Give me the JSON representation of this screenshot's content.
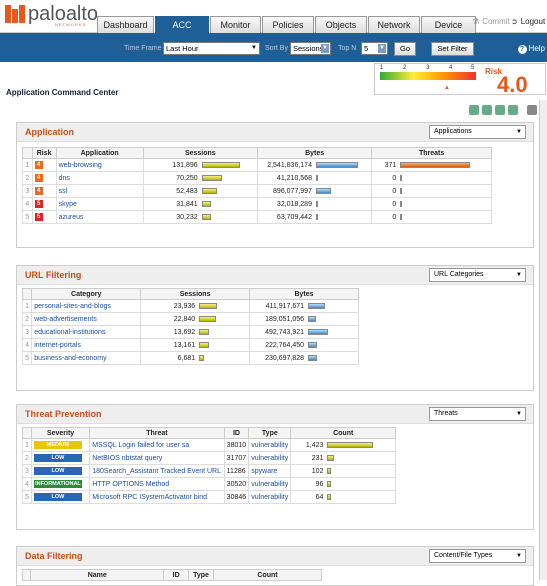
{
  "header": {
    "logo_text": "paloalto",
    "logo_sub": "NETWORKS",
    "tabs": [
      "Dashboard",
      "ACC",
      "Monitor",
      "Policies",
      "Objects",
      "Network",
      "Device"
    ],
    "commit": "Commit",
    "logout": "Logout"
  },
  "toolbar": {
    "time_frame_label": "Time Frame",
    "time_frame_value": "Last Hour",
    "sort_by_label": "Sort By",
    "sort_by_value": "Sessions",
    "top_n_label": "Top N",
    "top_n_value": "5",
    "go": "Go",
    "set_filter": "Set Filter",
    "help": "Help"
  },
  "page_title": "Application Command Center",
  "risk": {
    "label": "Risk",
    "value": "4.0",
    "ticks": [
      "1",
      "2",
      "3",
      "4",
      "5"
    ]
  },
  "application": {
    "title": "Application",
    "select": "Applications",
    "columns": [
      "Risk",
      "Application",
      "Sessions",
      "Bytes",
      "Threats"
    ],
    "rows": [
      {
        "n": "1",
        "risk": "4",
        "app": "web-browsing",
        "sessions": "131,896",
        "sessions_frac": 1.0,
        "bytes": "2,541,836,174",
        "bytes_frac": 1.0,
        "threats": "371",
        "threats_frac": 1.0
      },
      {
        "n": "2",
        "risk": "4",
        "app": "dns",
        "sessions": "70,250",
        "sessions_frac": 0.53,
        "bytes": "41,210,568",
        "bytes_frac": 0.02,
        "threats": "0",
        "threats_frac": 0
      },
      {
        "n": "3",
        "risk": "4",
        "app": "ssl",
        "sessions": "52,483",
        "sessions_frac": 0.4,
        "bytes": "896,077,997",
        "bytes_frac": 0.35,
        "threats": "0",
        "threats_frac": 0
      },
      {
        "n": "4",
        "risk": "5",
        "app": "skype",
        "sessions": "31,841",
        "sessions_frac": 0.24,
        "bytes": "32,018,289",
        "bytes_frac": 0.02,
        "threats": "0",
        "threats_frac": 0
      },
      {
        "n": "5",
        "risk": "5",
        "app": "azureus",
        "sessions": "30,232",
        "sessions_frac": 0.23,
        "bytes": "63,709,442",
        "bytes_frac": 0.03,
        "threats": "0",
        "threats_frac": 0
      }
    ]
  },
  "url_filtering": {
    "title": "URL Filtering",
    "select": "URL Categories",
    "columns": [
      "Category",
      "Sessions",
      "Bytes"
    ],
    "rows": [
      {
        "n": "1",
        "cat": "personal-sites-and-blogs",
        "sessions": "23,936",
        "sessions_frac": 1.0,
        "bytes": "411,917,671",
        "bytes_frac": 0.84
      },
      {
        "n": "2",
        "cat": "web-advertisements",
        "sessions": "22,840",
        "sessions_frac": 0.95,
        "bytes": "189,051,056",
        "bytes_frac": 0.38
      },
      {
        "n": "3",
        "cat": "educational-institutions",
        "sessions": "13,692",
        "sessions_frac": 0.57,
        "bytes": "492,743,921",
        "bytes_frac": 1.0
      },
      {
        "n": "4",
        "cat": "internet-portals",
        "sessions": "13,161",
        "sessions_frac": 0.55,
        "bytes": "222,764,450",
        "bytes_frac": 0.45
      },
      {
        "n": "5",
        "cat": "business-and-economy",
        "sessions": "6,681",
        "sessions_frac": 0.28,
        "bytes": "230,697,828",
        "bytes_frac": 0.47
      }
    ]
  },
  "threat_prevention": {
    "title": "Threat Prevention",
    "select": "Threats",
    "columns": [
      "Severity",
      "Threat",
      "ID",
      "Type",
      "Count"
    ],
    "rows": [
      {
        "n": "1",
        "sev": "MEDIUM",
        "sev_color": "#e8c800",
        "threat": "MSSQL Login failed for user sa",
        "id": "38010",
        "type": "vulnerability",
        "count": "1,423",
        "count_frac": 1.0
      },
      {
        "n": "2",
        "sev": "LOW",
        "sev_color": "#2a66b8",
        "threat": "NetBIOS nbtstat query",
        "id": "31707",
        "type": "vulnerability",
        "count": "231",
        "count_frac": 0.16
      },
      {
        "n": "3",
        "sev": "LOW",
        "sev_color": "#2a66b8",
        "threat": "180Search_Assistant Tracked Event URL",
        "id": "11286",
        "type": "spyware",
        "count": "102",
        "count_frac": 0.07
      },
      {
        "n": "4",
        "sev": "INFORMATIONAL",
        "sev_color": "#2f8a3a",
        "threat": "HTTP OPTIONS Method",
        "id": "30520",
        "type": "vulnerability",
        "count": "96",
        "count_frac": 0.07
      },
      {
        "n": "5",
        "sev": "LOW",
        "sev_color": "#2a66b8",
        "threat": "Microsoft RPC ISystemActivator bind",
        "id": "30846",
        "type": "vulnerability",
        "count": "64",
        "count_frac": 0.05
      }
    ]
  },
  "data_filtering": {
    "title": "Data Filtering",
    "select": "Content/File Types",
    "columns": [
      "Name",
      "ID",
      "Type",
      "Count"
    ]
  }
}
